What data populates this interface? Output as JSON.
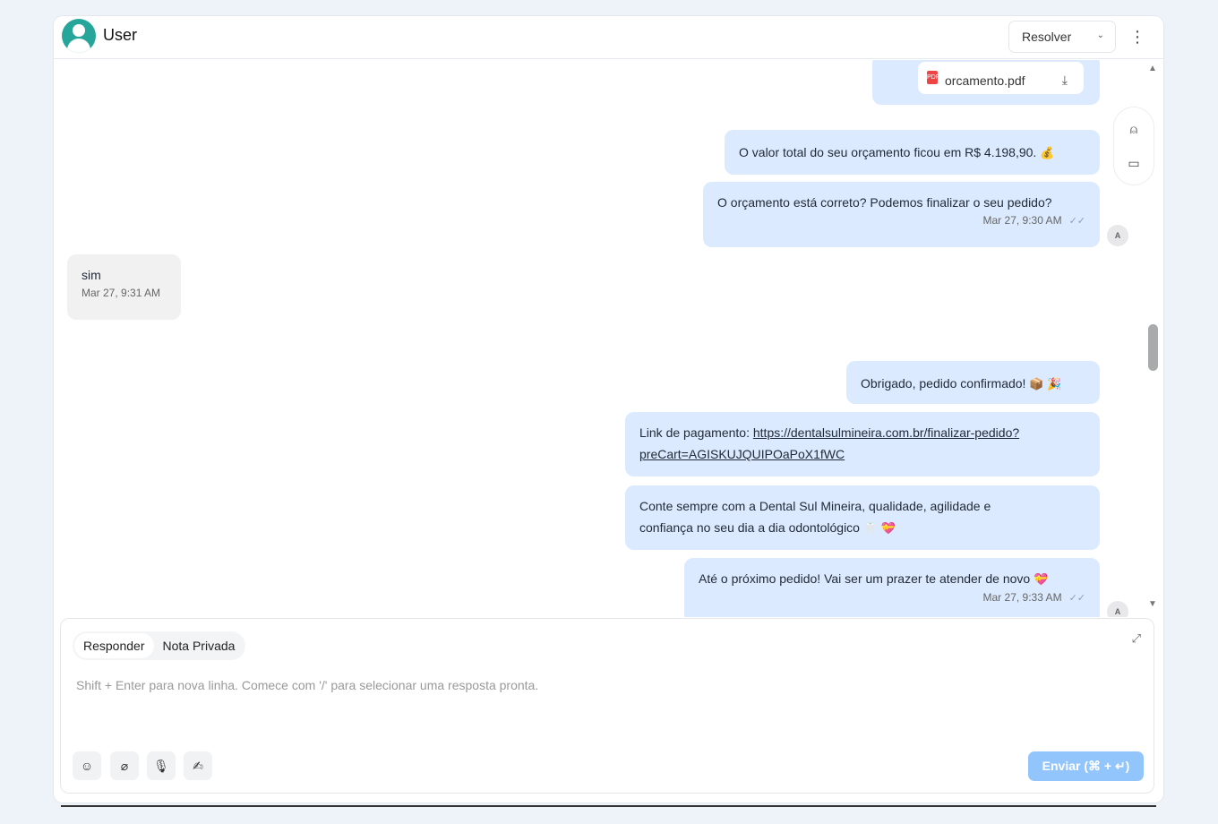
{
  "header": {
    "user_name": "User",
    "resolve_label": "Resolver",
    "resolve_chevron": "⌄",
    "menu_glyph": "⋮"
  },
  "messages": {
    "pdf": {
      "icon_label": "PDF",
      "file_name": "orcamento.pdf",
      "download_glyph": "⤓"
    },
    "msg_total": {
      "text": "O valor total do seu orçamento ficou em R$ 4.198,90.",
      "emoji": "💰"
    },
    "msg_confirm": {
      "text": "O orçamento está correto? Podemos finalizar o seu pedido?",
      "timestamp": "Mar 27, 9:30 AM"
    },
    "msg_sim": {
      "text": "sim",
      "timestamp": "Mar 27, 9:31 AM"
    },
    "msg_thanks": {
      "text": "Obrigado, pedido confirmado!",
      "emoji": "📦 🎉"
    },
    "msg_link": {
      "prefix": "Link de pagamento:",
      "url_line1": "https://dentalsulmineira.com.br/finalizar-pedido?",
      "url_line2": "preCart=AGISKUJQUIPOaPoX1fWC"
    },
    "msg_conte": {
      "line1": "Conte sempre com a Dental Sul Mineira, qualidade, agilidade e",
      "line2": "confiança no seu dia a dia odontológico",
      "emoji": "🦷 💝"
    },
    "msg_ate": {
      "text": "Até o próximo pedido! Vai ser um prazer te atender de novo",
      "emoji": "💝",
      "timestamp": "Mar 27, 9:33 AM"
    },
    "agent_initial": "A",
    "read_glyph": "✓✓"
  },
  "side_panel": {
    "contact_glyph": "⍝",
    "card_glyph": "▭"
  },
  "scrollbar": {
    "up_glyph": "▲",
    "down_glyph": "▼"
  },
  "composer": {
    "tab_reply": "Responder",
    "tab_private": "Nota Privada",
    "expand_glyph": "⤢",
    "placeholder": "Shift + Enter para nova linha. Comece com '/' para selecionar uma resposta pronta.",
    "tools": {
      "emoji": "☺",
      "attach": "⌀",
      "mic": "🎙",
      "signature": "✍"
    },
    "send_label": "Enviar (⌘ + ↵)"
  }
}
